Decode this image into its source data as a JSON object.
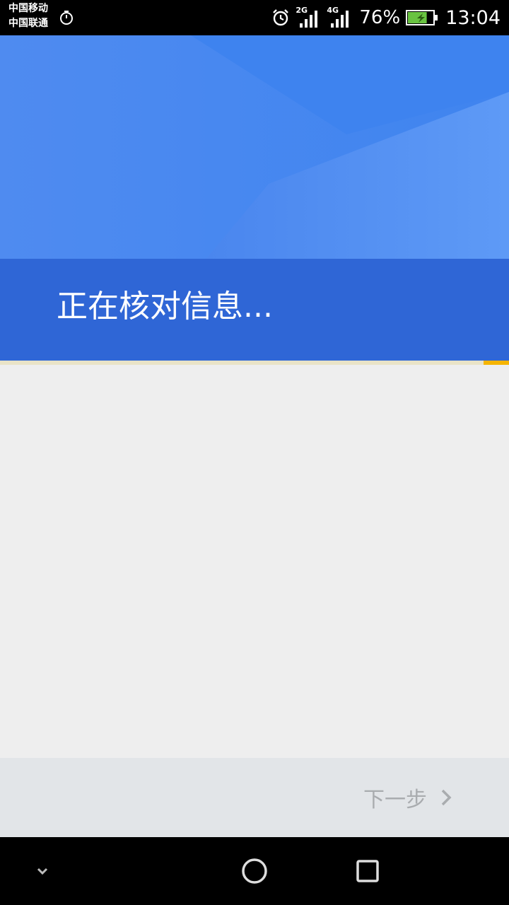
{
  "status_bar": {
    "carrier_1": "中国移动",
    "carrier_2": "中国联通",
    "signal_1_type": "2G",
    "signal_2_type": "4G",
    "battery_percent": "76%",
    "battery_level": 0.76,
    "time": "13:04",
    "icons": [
      "stopwatch-icon",
      "alarm-icon",
      "signal-icon",
      "battery-charging-icon"
    ]
  },
  "header": {
    "title": "正在核对信息...",
    "progress_fraction": 0.05,
    "colors": {
      "band": "#2f66d6",
      "background": "#4a86ee",
      "progress": "#f5b400"
    }
  },
  "footer": {
    "next_label": "下一步",
    "next_icon": "chevron-right-icon",
    "next_color": "#a9acaf"
  },
  "nav_bar": {
    "back_icon": "chevron-down-icon",
    "home_icon": "circle-home-icon",
    "recents_icon": "square-recents-icon"
  }
}
